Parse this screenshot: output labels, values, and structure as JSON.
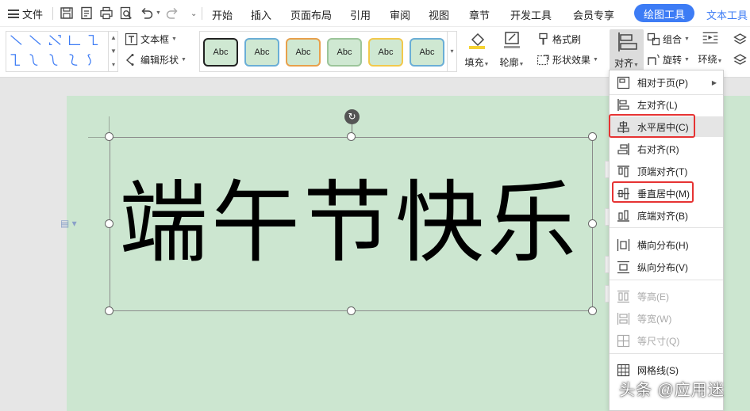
{
  "menubar": {
    "file_label": "文件",
    "tabs": [
      "开始",
      "插入",
      "页面布局",
      "引用",
      "审阅",
      "视图",
      "章节",
      "开发工具",
      "会员专享",
      "绘图工具",
      "文本工具"
    ],
    "active_tab": "绘图工具",
    "accent": "#3d7cf5"
  },
  "toolbar": {
    "textbox_label": "文本框",
    "edit_shape_label": "编辑形状",
    "style_samples": [
      "Abc",
      "Abc",
      "Abc",
      "Abc",
      "Abc",
      "Abc"
    ],
    "style_border_colors": [
      "#222222",
      "#6aaed6",
      "#e8a04b",
      "#9cc59a",
      "#f2c94c",
      "#6aaed6"
    ],
    "fill_label": "填充",
    "outline_label": "轮廓",
    "format_brush_label": "格式刷",
    "shape_effect_label": "形状效果",
    "align_label": "对齐",
    "group_label": "组合",
    "rotate_label": "旋转",
    "wrap_label": "环绕"
  },
  "document": {
    "textbox_text": "端午节快乐",
    "page_color": "#cce6d0"
  },
  "align_menu": {
    "items": [
      {
        "label": "相对于页(P)",
        "icon": "page-relative-icon",
        "disabled": false,
        "has_submenu": true
      },
      {
        "label": "左对齐(L)",
        "icon": "align-left-icon",
        "disabled": false
      },
      {
        "label": "水平居中(C)",
        "icon": "align-center-horizontal-icon",
        "disabled": false
      },
      {
        "label": "右对齐(R)",
        "icon": "align-right-icon",
        "disabled": false
      },
      {
        "label": "顶端对齐(T)",
        "icon": "align-top-icon",
        "disabled": false
      },
      {
        "label": "垂直居中(M)",
        "icon": "align-middle-vertical-icon",
        "disabled": false
      },
      {
        "label": "底端对齐(B)",
        "icon": "align-bottom-icon",
        "disabled": false
      },
      {
        "label": "横向分布(H)",
        "icon": "distribute-horizontal-icon",
        "disabled": false
      },
      {
        "label": "纵向分布(V)",
        "icon": "distribute-vertical-icon",
        "disabled": false
      },
      {
        "label": "等高(E)",
        "icon": "same-height-icon",
        "disabled": true
      },
      {
        "label": "等宽(W)",
        "icon": "same-width-icon",
        "disabled": true
      },
      {
        "label": "等尺寸(Q)",
        "icon": "same-size-icon",
        "disabled": true
      },
      {
        "label": "网格线(S)",
        "icon": "gridlines-icon",
        "disabled": false
      }
    ],
    "hovered_item": "水平居中(C)",
    "highlighted_items": [
      "水平居中(C)",
      "垂直居中(M)"
    ],
    "highlight_color": "#e63333"
  },
  "watermark": {
    "text": "头条 @应用迷"
  }
}
